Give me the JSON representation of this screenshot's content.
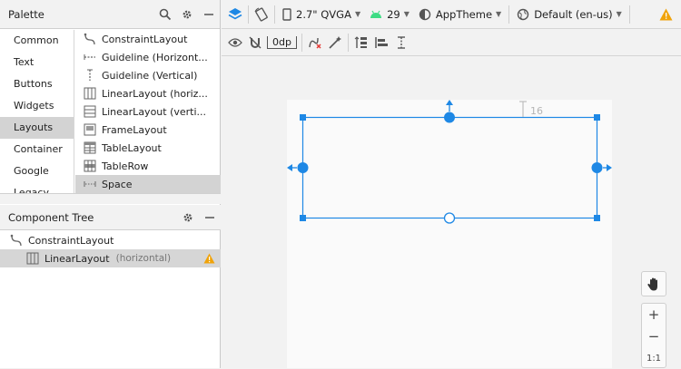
{
  "palette": {
    "title": "Palette",
    "categories": [
      "Common",
      "Text",
      "Buttons",
      "Widgets",
      "Layouts",
      "Container",
      "Google",
      "Legacy"
    ],
    "selected_category": "Layouts",
    "items": [
      {
        "label": "ConstraintLayout",
        "icon": "constraint-icon"
      },
      {
        "label": "Guideline (Horizont...",
        "icon": "guideline-horizontal-icon"
      },
      {
        "label": "Guideline (Vertical)",
        "icon": "guideline-vertical-icon"
      },
      {
        "label": "LinearLayout (horiz...",
        "icon": "linear-horizontal-icon"
      },
      {
        "label": "LinearLayout (verti...",
        "icon": "linear-vertical-icon"
      },
      {
        "label": "FrameLayout",
        "icon": "frame-icon"
      },
      {
        "label": "TableLayout",
        "icon": "table-icon"
      },
      {
        "label": "TableRow",
        "icon": "table-row-icon"
      },
      {
        "label": "Space",
        "icon": "space-icon"
      }
    ],
    "selected_item": "Space"
  },
  "tree": {
    "title": "Component Tree",
    "root": "ConstraintLayout",
    "child": {
      "label": "LinearLayout",
      "hint": "(horizontal)"
    }
  },
  "toolbar": {
    "device": "2.7\" QVGA",
    "api": "29",
    "theme": "AppTheme",
    "locale": "Default (en-us)",
    "margin": "0dp"
  },
  "canvas": {
    "margin_label": "16"
  },
  "zoom": {
    "zoom_in": "+",
    "zoom_out": "−",
    "actual": "1:1"
  },
  "colors": {
    "accent": "#1e88e5",
    "android_green": "#3ddc84",
    "warning": "#f0a30a"
  }
}
